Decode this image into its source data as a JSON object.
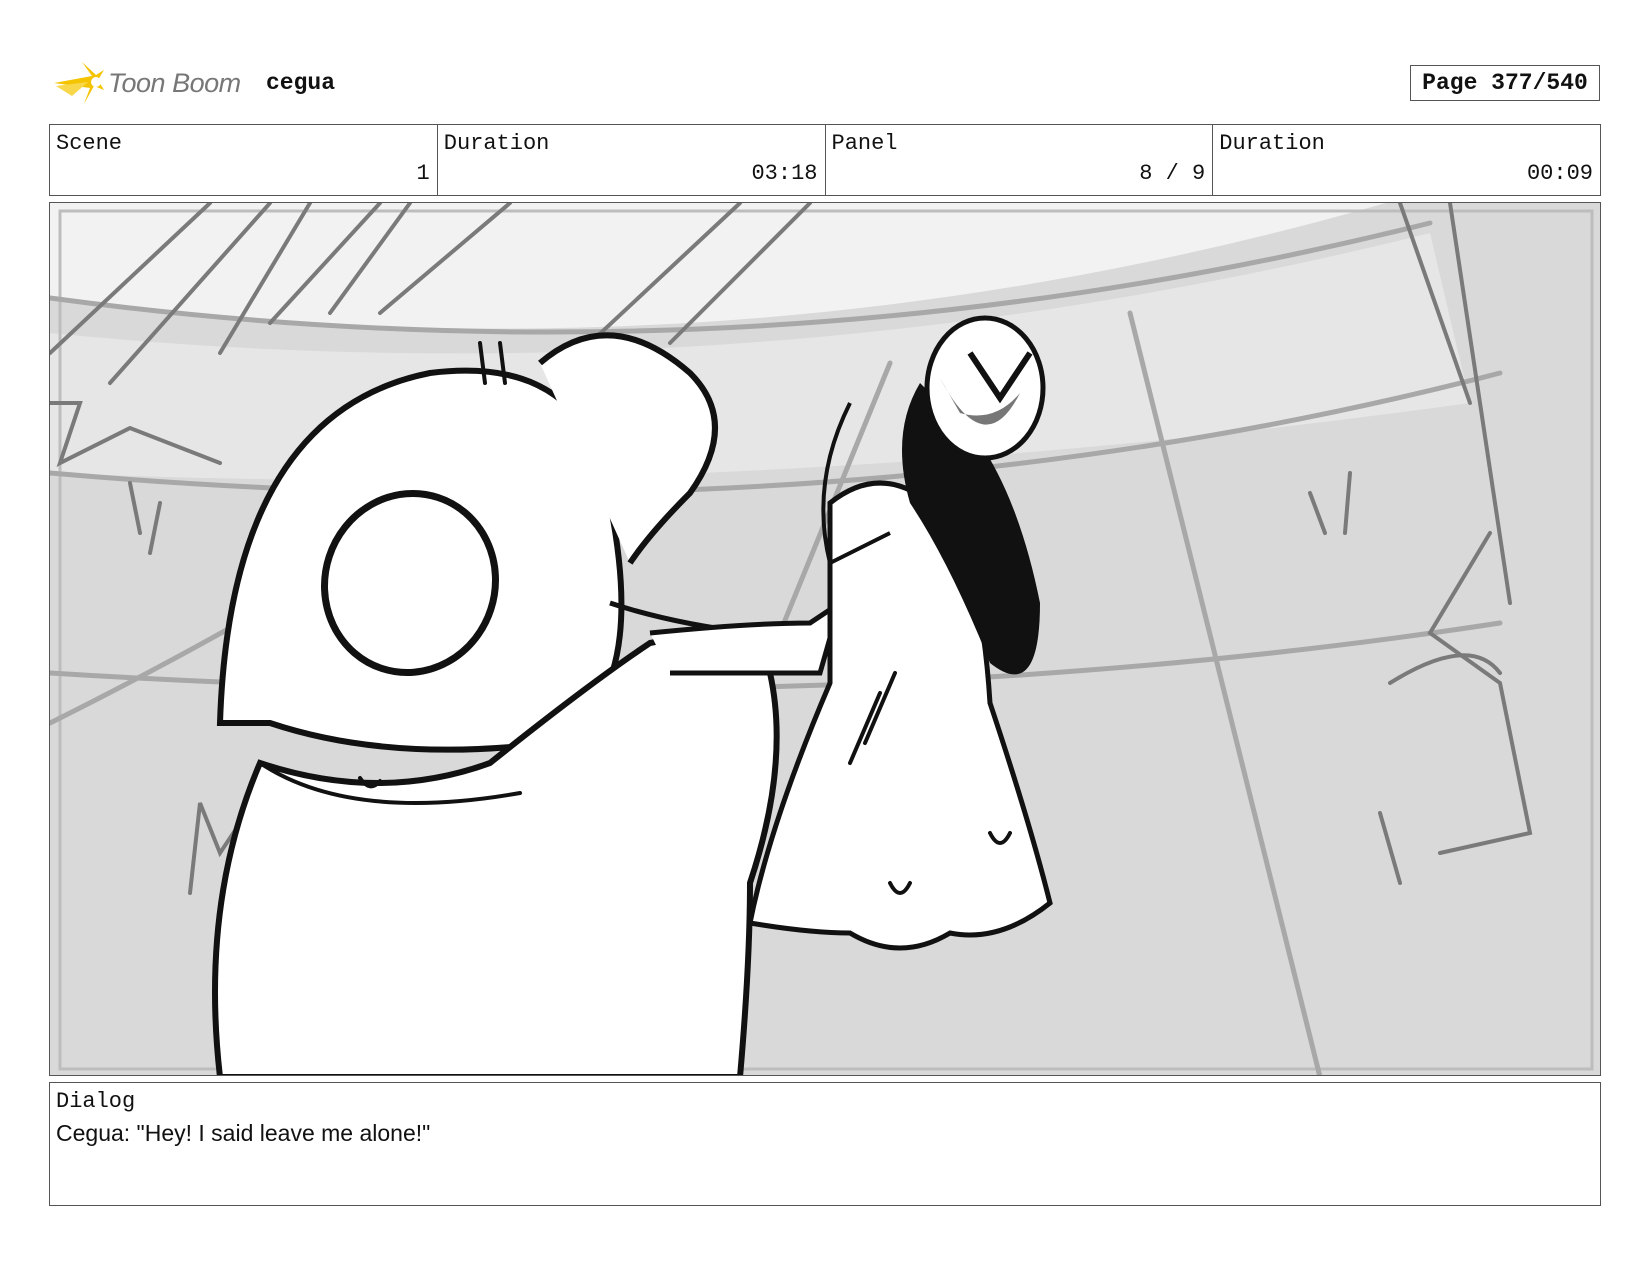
{
  "header": {
    "logo_text": "Toon Boom",
    "logo_accent_color": "#f5c400",
    "project_name": "cegua",
    "page_label": "Page 377/540"
  },
  "info": {
    "scene_label": "Scene",
    "scene_value": "1",
    "duration_label": "Duration",
    "duration_value": "03:18",
    "panel_label": "Panel",
    "panel_value": "8 / 9",
    "panel_duration_label": "Duration",
    "panel_duration_value": "00:09"
  },
  "panel_image": {
    "icon": "storyboard-sketch"
  },
  "dialog": {
    "label": "Dialog",
    "text": "Cegua: \"Hey! I said leave me alone!\""
  }
}
